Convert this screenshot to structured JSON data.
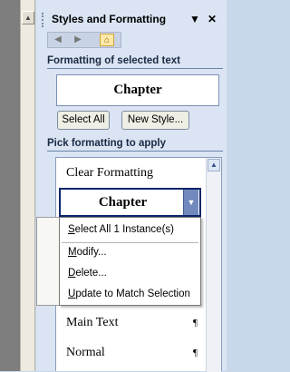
{
  "pane": {
    "title": "Styles and Formatting",
    "dropdown_glyph": "▼",
    "close_glyph": "✕"
  },
  "toolbar": {
    "back_icon": "back-arrow-icon",
    "forward_icon": "forward-arrow-icon",
    "home_icon": "home-icon"
  },
  "selected_section": {
    "label": "Formatting of selected text",
    "preview": "Chapter",
    "select_all_button": "Select All",
    "new_style_button": "New Style..."
  },
  "apply_section": {
    "label": "Pick formatting to apply",
    "items": [
      {
        "label": "Clear Formatting",
        "mark": ""
      },
      {
        "label": "Chapter",
        "mark": ""
      },
      {
        "label": "Main Text",
        "mark": "¶"
      },
      {
        "label": "Normal",
        "mark": "¶"
      }
    ]
  },
  "context_menu": {
    "items": [
      {
        "label": "Select All 1 Instance(s)"
      },
      {
        "label": "Modify..."
      },
      {
        "label": "Delete..."
      },
      {
        "label": "Update to Match Selection"
      }
    ]
  },
  "colors": {
    "pane_bg": "#dae4f2",
    "section_label": "#1b2a45",
    "selection_border": "#0a246a",
    "dropdown_arrow_bg": "#7289bd"
  }
}
